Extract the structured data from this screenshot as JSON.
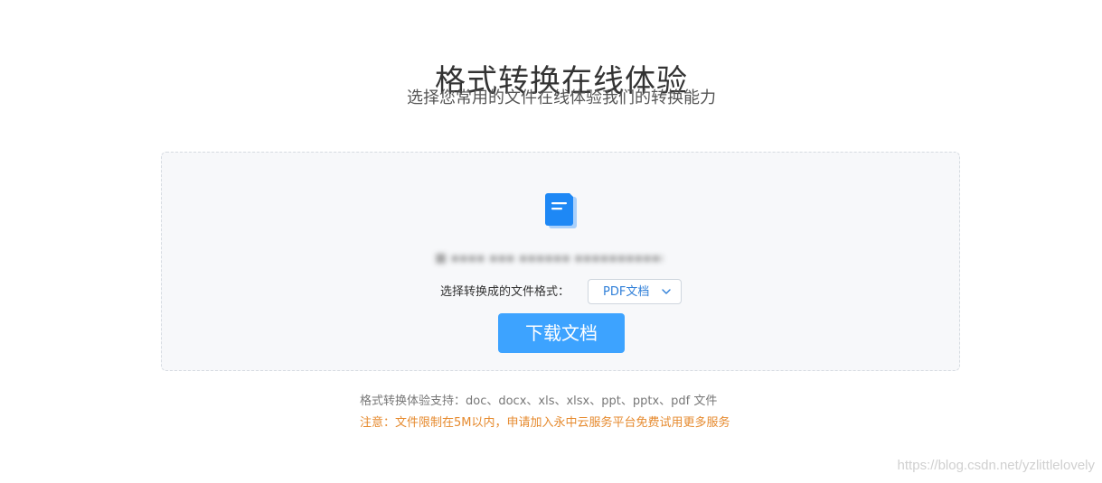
{
  "header": {
    "title": "格式转换在线体验",
    "subtitle": "选择您常用的文件在线体验我们的转换能力"
  },
  "upload_panel": {
    "file_icon": "document-icon",
    "file_name": "■ ▪▪▪▪ ▪▪▪ ▪▪▪▪▪▪ ▪▪▪▪▪▪▪▪▪▪▪",
    "format_label": "选择转换成的文件格式：",
    "format_select": {
      "selected": "PDF文档",
      "icon": "chevron-down-icon"
    },
    "download_label": "下载文档"
  },
  "footer": {
    "support_text": "格式转换体验支持：doc、docx、xls、xlsx、ppt、pptx、pdf 文件",
    "notice_text": "注意：文件限制在5M以内，申请加入永中云服务平台免费试用更多服务"
  },
  "watermark": "https://blog.csdn.net/yzlittlelovely",
  "colors": {
    "accent": "#3da3ff",
    "icon_blue": "#1e88f5",
    "select_text": "#2f7fd8",
    "notice": "#e68a2e",
    "panel_bg": "#f7f8fa"
  }
}
